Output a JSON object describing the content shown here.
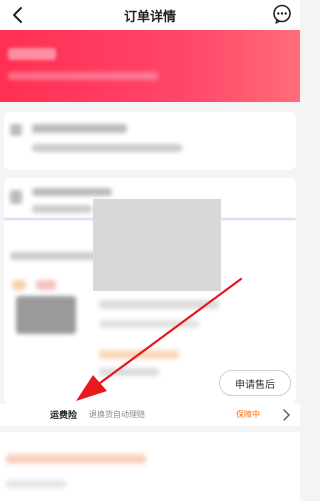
{
  "header": {
    "title": "订单详情",
    "back_icon": "chevron-left-icon",
    "more_icon": "chat-more-icon"
  },
  "colors": {
    "banner": "#ff3a5c",
    "accent": "#ff6b00",
    "arrow": "#e8181c"
  },
  "after_sale": {
    "label": "申请售后"
  },
  "shipping_insurance": {
    "label": "运费险",
    "description": "退换货自动理赔",
    "status": "保障中",
    "chevron_icon": "chevron-right-icon"
  }
}
